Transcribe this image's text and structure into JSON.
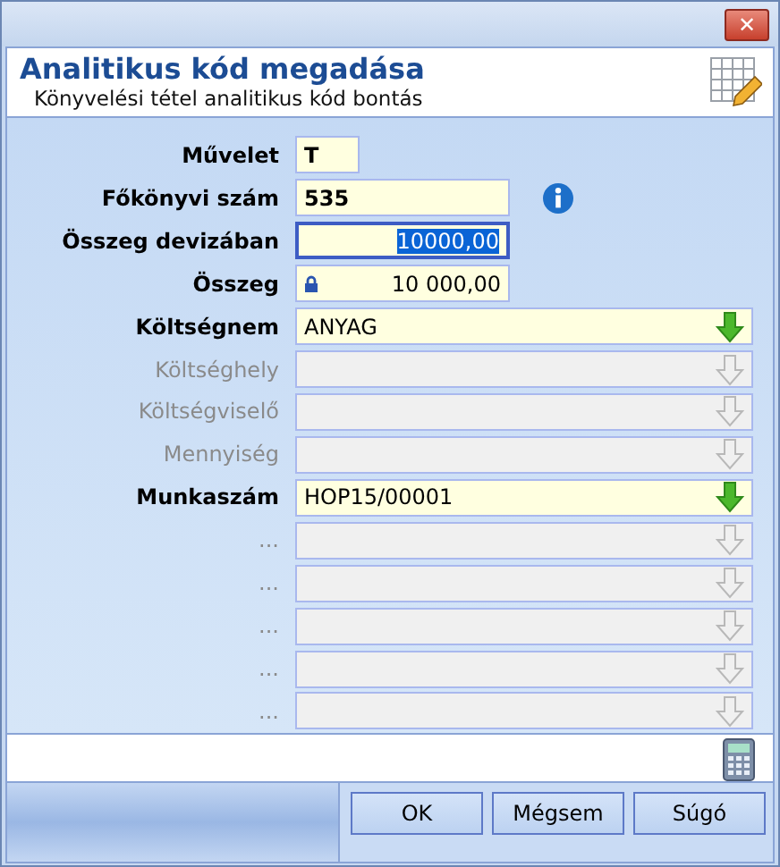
{
  "window": {
    "close": "✕"
  },
  "header": {
    "title": "Analitikus kód megadása",
    "subtitle": "Könyvelési tétel analitikus kód bontás"
  },
  "rows": [
    {
      "kind": "short",
      "label": "Művelet",
      "value": "T",
      "disabled": false
    },
    {
      "kind": "info",
      "label": "Főkönyvi szám",
      "value": "535",
      "disabled": false
    },
    {
      "kind": "amount",
      "label": "Összeg devizában",
      "value": "10000,00",
      "disabled": false,
      "focused": true,
      "locked": false
    },
    {
      "kind": "amount",
      "label": "Összeg",
      "value": "10 000,00",
      "disabled": false,
      "focused": false,
      "locked": true
    },
    {
      "kind": "lookup",
      "label": "Költségnem",
      "value": "ANYAG",
      "disabled": false
    },
    {
      "kind": "lookup",
      "label": "Költséghely",
      "disabled": true
    },
    {
      "kind": "lookup",
      "label": "Költségviselő",
      "disabled": true
    },
    {
      "kind": "lookup",
      "label": "Mennyiség",
      "disabled": true
    },
    {
      "kind": "lookup",
      "label": "Munkaszám",
      "value": "HOP15/00001",
      "disabled": false
    },
    {
      "kind": "lookup",
      "label": "...",
      "disabled": true
    },
    {
      "kind": "lookup",
      "label": "...",
      "disabled": true
    },
    {
      "kind": "lookup",
      "label": "...",
      "disabled": true
    },
    {
      "kind": "lookup",
      "label": "...",
      "disabled": true
    },
    {
      "kind": "lookup",
      "label": "...",
      "disabled": true
    }
  ],
  "buttons": [
    "OK",
    "Mégsem",
    "Súgó"
  ]
}
